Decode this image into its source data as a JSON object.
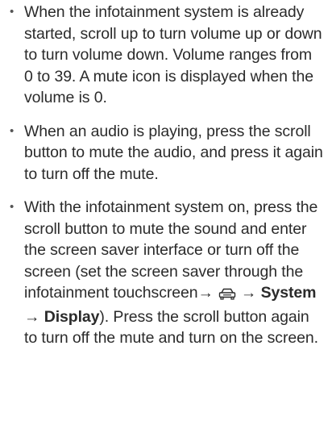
{
  "bullets": [
    {
      "marker": "•",
      "text": "When the infotainment system is already started, scroll up to turn volume up or down to turn volume down. Volume ranges from 0 to 39. A mute icon is displayed when the volume is 0."
    },
    {
      "marker": "•",
      "text": "When an audio is playing, press the scroll button to mute the audio, and press it again to turn off the mute."
    },
    {
      "marker": "•",
      "text_before_icon": "With the infotainment system on, press the scroll button to mute the sound and enter the screen saver interface or turn off the screen (set the screen saver through the infotainment touchscreen→",
      "icon": "car-icon",
      "arrow_1": "→",
      "system": "System",
      "arrow_2": "→",
      "display": "Display",
      "text_after": "). Press the scroll button again to turn off the mute and turn on the screen."
    }
  ]
}
